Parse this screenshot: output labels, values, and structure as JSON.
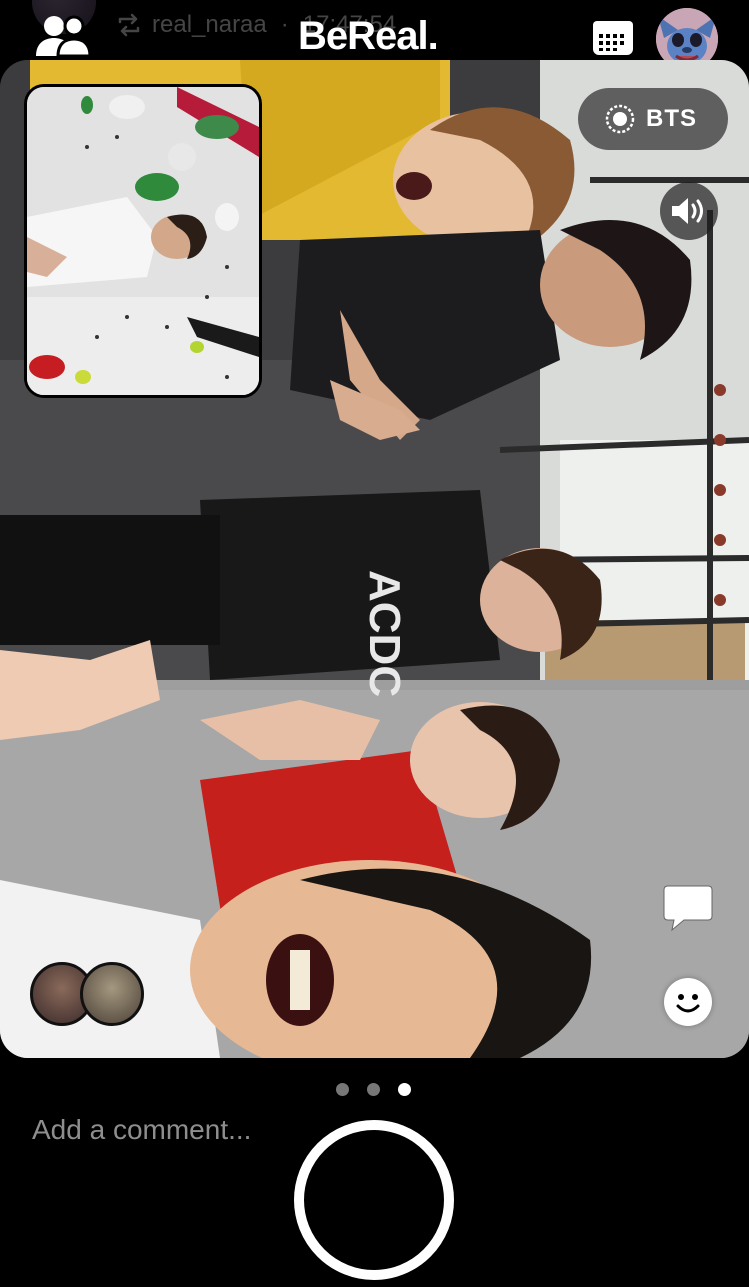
{
  "header": {
    "brand": "BeReal.",
    "repost": {
      "icon": "repost-icon",
      "username": "real_naraa",
      "separator": "·",
      "time": "17:47:54"
    },
    "icons": {
      "friends": "friends-icon",
      "calendar": "calendar-icon",
      "profile": "profile-avatar"
    }
  },
  "post": {
    "bts_label": "BTS",
    "icons": {
      "bts": "record-icon",
      "sound": "speaker-icon",
      "comment": "comment-bubble-icon",
      "react": "smiley-icon"
    },
    "reaction_avatar_count": 2
  },
  "pager": {
    "total": 3,
    "active_index": 2
  },
  "comment": {
    "placeholder": "Add a comment..."
  },
  "colors": {
    "background": "#000000",
    "text": "#ffffff",
    "muted": "#8e8e8e"
  }
}
